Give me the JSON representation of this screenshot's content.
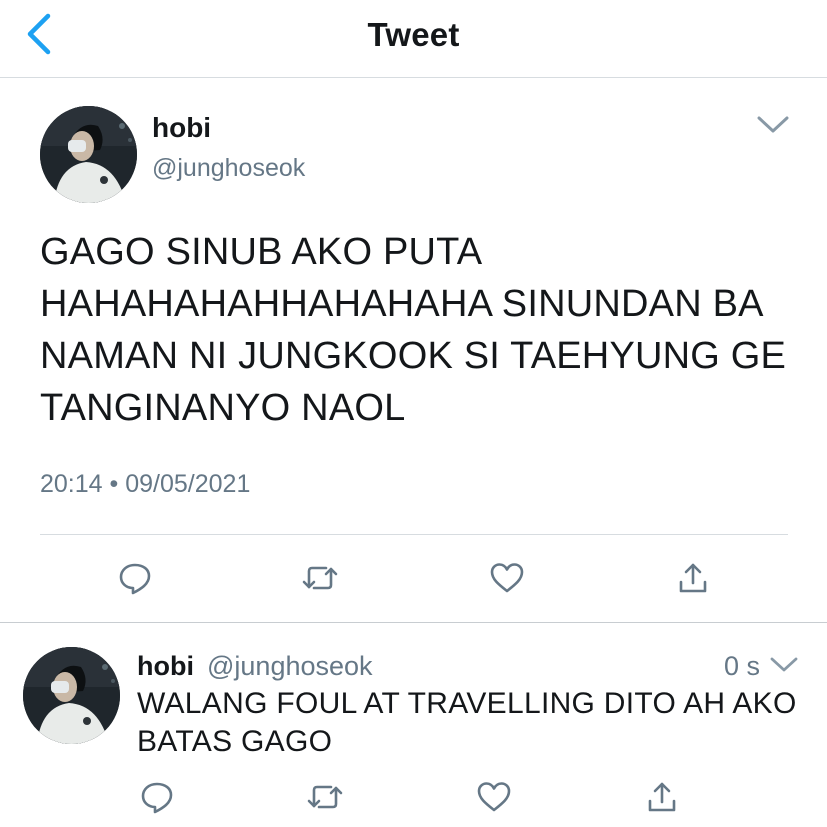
{
  "header": {
    "title": "Tweet",
    "back_icon": "chevron-left-icon",
    "accent_color": "#1da1f2"
  },
  "tweet": {
    "author_name": "hobi",
    "author_handle": "@junghoseok",
    "text": "GAGO SINUB AKO PUTA HAHAHAHAHHAHAHAHA SINUNDAN BA NAMAN NI JUNGKOOK SI TAEHYUNG GE TANGINANYO NAOL",
    "time": "20:14",
    "separator": "•",
    "date": "09/05/2021",
    "actions": [
      "reply-icon",
      "retweet-icon",
      "like-icon",
      "share-icon"
    ]
  },
  "reply": {
    "author_name": "hobi",
    "author_handle": "@junghoseok",
    "time": "0 s",
    "text": "WALANG FOUL AT TRAVELLING DITO AH AKO BATAS GAGO",
    "actions": [
      "reply-icon",
      "retweet-icon",
      "like-icon",
      "share-icon"
    ]
  },
  "colors": {
    "text": "#14171a",
    "secondary": "#657786",
    "icon": "#657786",
    "divider": "#d7dce0"
  }
}
